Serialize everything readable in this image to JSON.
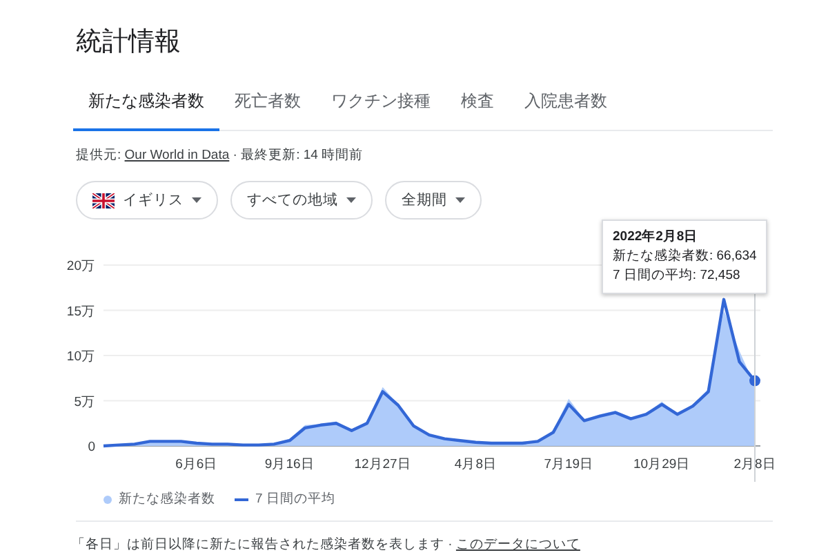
{
  "title": "統計情報",
  "tabs": [
    {
      "label": "新たな感染者数",
      "selected": true
    },
    {
      "label": "死亡者数",
      "selected": false
    },
    {
      "label": "ワクチン接種",
      "selected": false
    },
    {
      "label": "検査",
      "selected": false
    },
    {
      "label": "入院患者数",
      "selected": false
    }
  ],
  "source": {
    "label": "提供元:",
    "link": "Our World in Data",
    "updated": "· 最終更新: 14 時間前"
  },
  "filters": [
    {
      "label": "イギリス",
      "kind": "flag"
    },
    {
      "label": "すべての地域",
      "kind": "plain"
    },
    {
      "label": "全期間",
      "kind": "plain"
    }
  ],
  "chart": {
    "chart_data": {
      "type": "area",
      "categories": [
        null,
        null,
        null,
        null,
        null,
        null,
        "6月6日",
        null,
        null,
        null,
        null,
        null,
        "9月16日",
        null,
        null,
        null,
        null,
        null,
        "12月27日",
        null,
        null,
        null,
        null,
        null,
        "4月8日",
        null,
        null,
        null,
        null,
        null,
        "7月19日",
        null,
        null,
        null,
        null,
        null,
        "10月29日",
        null,
        null,
        null,
        null,
        null,
        "2月8日"
      ],
      "series": [
        {
          "name": "新たな感染者数",
          "color": "#aecbfa",
          "values": [
            0,
            0.1,
            0.2,
            0.5,
            0.5,
            0.4,
            0.3,
            0.2,
            0.2,
            0.1,
            0.1,
            0.3,
            0.8,
            2.3,
            2.4,
            2.7,
            1.8,
            2.7,
            6.5,
            4.6,
            2.3,
            1.2,
            0.8,
            0.6,
            0.4,
            0.3,
            0.3,
            0.3,
            0.6,
            1.7,
            5.2,
            2.9,
            3.5,
            3.9,
            3.1,
            3.6,
            4.9,
            3.5,
            4.6,
            6.3,
            15,
            10.5,
            6.7
          ]
        },
        {
          "name": "7 日間の平均",
          "type": "line",
          "color": "#3367d6",
          "values": [
            0,
            0.1,
            0.2,
            0.5,
            0.5,
            0.5,
            0.3,
            0.2,
            0.2,
            0.1,
            0.1,
            0.2,
            0.6,
            2,
            2.3,
            2.5,
            1.7,
            2.5,
            6,
            4.5,
            2.2,
            1.2,
            0.8,
            0.6,
            0.4,
            0.3,
            0.3,
            0.3,
            0.5,
            1.5,
            4.6,
            2.8,
            3.3,
            3.7,
            3,
            3.5,
            4.6,
            3.5,
            4.4,
            6,
            16.2,
            9.3,
            7.2
          ]
        }
      ],
      "ylim": [
        0,
        20
      ],
      "grid": true,
      "yticks": [
        {
          "value": 0,
          "label": "0"
        },
        {
          "value": 5,
          "label": "5万"
        },
        {
          "value": 10,
          "label": "10万"
        },
        {
          "value": 15,
          "label": "15万"
        },
        {
          "value": 20,
          "label": "20万"
        }
      ]
    },
    "tooltip": {
      "date": "2022年2月8日",
      "lines": [
        "新たな感染者数: 66,634",
        "7 日間の平均: 72,458"
      ]
    }
  },
  "note": {
    "text": "「各日」は前日以降に新たに報告された感染者数を表します ·",
    "link": "このデータについて"
  }
}
